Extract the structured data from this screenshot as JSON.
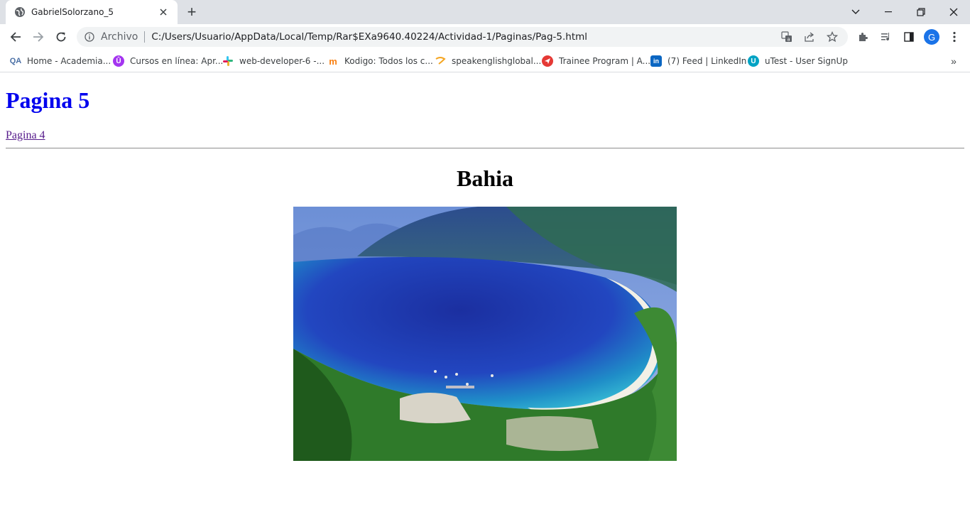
{
  "browser": {
    "tab_title": "GabrielSolorzano_5",
    "new_tab_symbol": "+",
    "url_scheme_label": "Archivo",
    "url": "C:/Users/Usuario/AppData/Local/Temp/Rar$EXa9640.40224/Actividad-1/Paginas/Pag-5.html",
    "profile_initial": "G",
    "accent_color": "#1a73e8"
  },
  "bookmarks": [
    {
      "label": "Home - Academia...",
      "icon": "academia-icon",
      "color": "#4a6fa5"
    },
    {
      "label": "Cursos en línea: Apr...",
      "icon": "udemy-icon",
      "color": "#a435f0"
    },
    {
      "label": "web-developer-6 -...",
      "icon": "slack-icon",
      "color": "#e01e5a"
    },
    {
      "label": "Kodigo: Todos los c...",
      "icon": "moodle-icon",
      "color": "#f98012"
    },
    {
      "label": "speakenglishglobal...",
      "icon": "speakenglish-icon",
      "color": "#f5a623"
    },
    {
      "label": "Trainee Program | A...",
      "icon": "trainee-icon",
      "color": "#e53935"
    },
    {
      "label": "(7) Feed | LinkedIn",
      "icon": "linkedin-icon",
      "color": "#0a66c2"
    },
    {
      "label": "uTest - User SignUp",
      "icon": "utest-icon",
      "color": "#00a3c4"
    }
  ],
  "bookmarks_overflow": "»",
  "page": {
    "heading": "Pagina 5",
    "link_text": "Pagina 4",
    "subheading": "Bahia",
    "heading_color": "#0000ee",
    "link_color": "#551a8b"
  }
}
